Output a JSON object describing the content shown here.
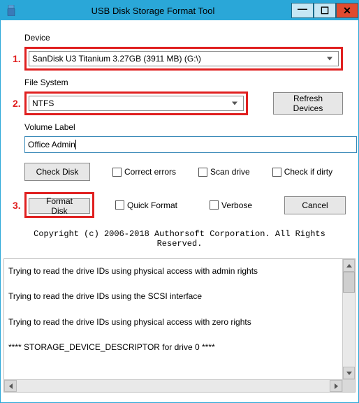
{
  "window": {
    "title": "USB Disk Storage Format Tool"
  },
  "labels": {
    "device": "Device",
    "file_system": "File System",
    "volume_label": "Volume Label"
  },
  "device": {
    "selected": "SanDisk U3 Titanium 3.27GB (3911 MB)  (G:\\)"
  },
  "file_system": {
    "selected": "NTFS"
  },
  "volume": {
    "value": "Office Admin"
  },
  "buttons": {
    "refresh": "Refresh Devices",
    "check": "Check Disk",
    "format": "Format Disk",
    "cancel": "Cancel"
  },
  "checkboxes": {
    "correct_errors": "Correct errors",
    "scan_drive": "Scan drive",
    "check_if_dirty": "Check if dirty",
    "quick_format": "Quick Format",
    "verbose": "Verbose"
  },
  "copyright": "Copyright (c) 2006-2018 Authorsoft Corporation. All Rights Reserved.",
  "annotations": {
    "n1": "1.",
    "n2": "2.",
    "n3": "3."
  },
  "log": {
    "lines": [
      "Trying to read the drive IDs using physical access with admin rights",
      "Trying to read the drive IDs using the SCSI interface",
      "Trying to read the drive IDs using physical access with zero rights",
      "**** STORAGE_DEVICE_DESCRIPTOR for drive 0 ****"
    ]
  }
}
